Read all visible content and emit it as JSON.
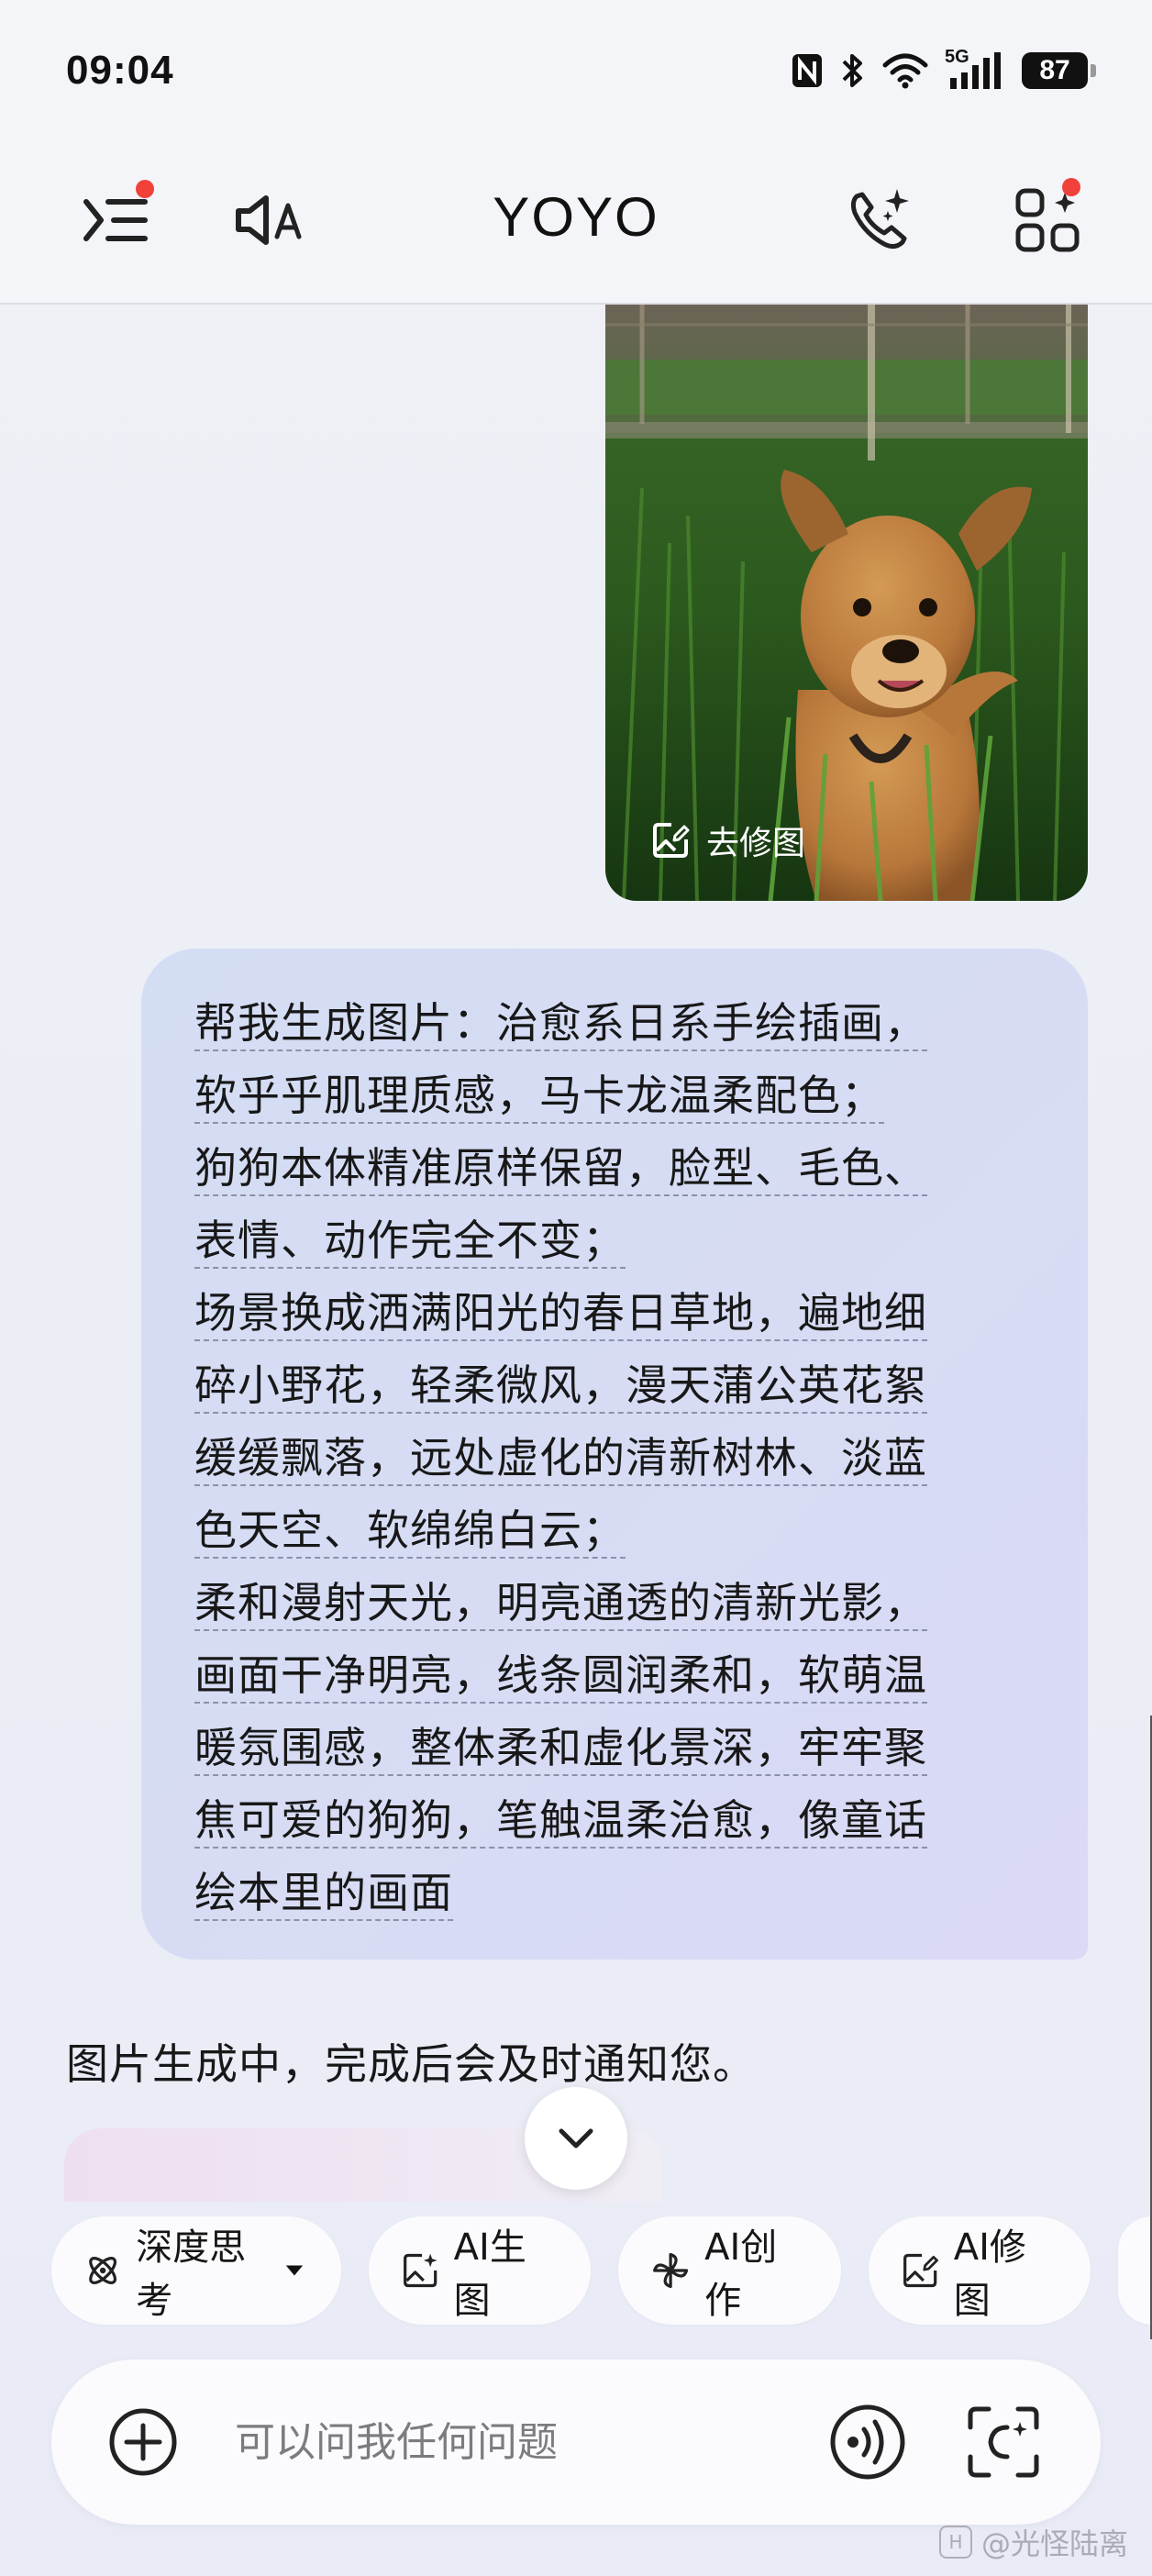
{
  "status_bar": {
    "time": "09:04",
    "network": "5G",
    "battery": "87",
    "icons": [
      "nfc-icon",
      "bluetooth-icon",
      "wifi-icon",
      "signal-icon",
      "battery-icon"
    ]
  },
  "header": {
    "title": "YOYO",
    "left_icons": [
      "menu-icon",
      "voice-broadcast-icon"
    ],
    "right_icons": [
      "ai-call-icon",
      "apps-icon"
    ],
    "notification_dot_color": "#f0413a"
  },
  "image_message": {
    "edit_label": "去修图",
    "description": "photo"
  },
  "user_message": {
    "lines": [
      "帮我生成图片：治愈系日系手绘插画，",
      "软乎乎肌理质感，马卡龙温柔配色；",
      "狗狗本体精准原样保留，脸型、毛色、",
      "表情、动作完全不变；",
      "场景换成洒满阳光的春日草地，遍地细",
      "碎小野花，轻柔微风，漫天蒲公英花絮",
      "缓缓飘落，远处虚化的清新树林、淡蓝",
      "色天空、软绵绵白云；",
      "柔和漫射天光，明亮通透的清新光影，",
      "画面干净明亮，线条圆润柔和，软萌温",
      "暖氛围感，整体柔和虚化景深，牢牢聚",
      "焦可爱的狗狗，笔触温柔治愈，像童话",
      "绘本里的画面"
    ]
  },
  "bot_message": {
    "text": "图片生成中，完成后会及时通知您。"
  },
  "chips": [
    {
      "label": "深度思考",
      "icon": "atom-icon",
      "has_dropdown": true
    },
    {
      "label": "AI生图",
      "icon": "image-generate-icon"
    },
    {
      "label": "AI创作",
      "icon": "pinwheel-icon"
    },
    {
      "label": "AI修图",
      "icon": "image-edit-icon"
    }
  ],
  "input": {
    "placeholder": "可以问我任何问题",
    "value": ""
  },
  "watermark": {
    "text": "@光怪陆离"
  },
  "colors": {
    "user_bubble": "#d5dcf4",
    "background": "#eceef6"
  }
}
